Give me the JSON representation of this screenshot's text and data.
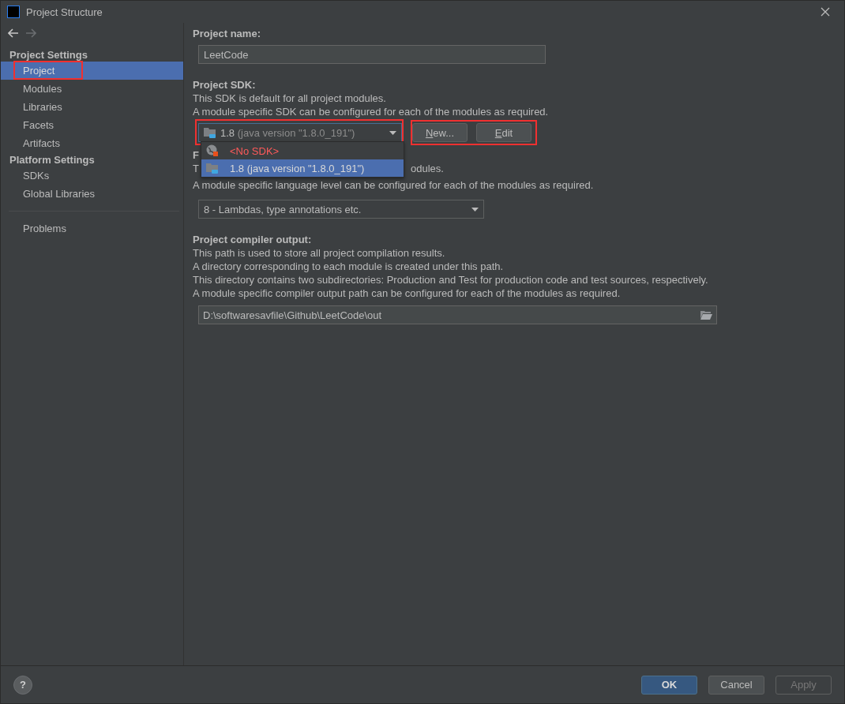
{
  "window": {
    "title": "Project Structure"
  },
  "sidebar": {
    "sections": [
      {
        "title": "Project Settings",
        "items": [
          {
            "label": "Project",
            "selected": true,
            "highlighted": true
          },
          {
            "label": "Modules",
            "selected": false,
            "highlighted": false
          },
          {
            "label": "Libraries",
            "selected": false,
            "highlighted": false
          },
          {
            "label": "Facets",
            "selected": false,
            "highlighted": false
          },
          {
            "label": "Artifacts",
            "selected": false,
            "highlighted": false
          }
        ]
      },
      {
        "title": "Platform Settings",
        "items": [
          {
            "label": "SDKs",
            "selected": false,
            "highlighted": false
          },
          {
            "label": "Global Libraries",
            "selected": false,
            "highlighted": false
          }
        ]
      }
    ],
    "extra_items": [
      {
        "label": "Problems",
        "selected": false
      }
    ]
  },
  "project_name": {
    "label": "Project name:",
    "value": "LeetCode"
  },
  "project_sdk": {
    "label": "Project SDK:",
    "description": [
      "This SDK is default for all project modules.",
      "A module specific SDK can be configured for each of the modules as required."
    ],
    "combo": {
      "version": "1.8",
      "detail": "(java version \"1.8.0_191\")",
      "highlighted": true
    },
    "buttons": [
      {
        "label": "New..."
      },
      {
        "label": "Edit"
      }
    ],
    "buttons_highlighted": true,
    "dropdown": {
      "options": [
        {
          "kind": "none",
          "label": "<No SDK>",
          "selected": false
        },
        {
          "kind": "jdk",
          "label": "1.8 (java version \"1.8.0_191\")",
          "selected": true
        }
      ]
    }
  },
  "language_level": {
    "label_fragment": "F",
    "line_fragments": [
      "T",
      "odules."
    ],
    "description": "A module specific language level can be configured for each of the modules as required.",
    "combo": {
      "value": "8 - Lambdas, type annotations etc."
    }
  },
  "compiler_output": {
    "label": "Project compiler output:",
    "description": [
      "This path is used to store all project compilation results.",
      "A directory corresponding to each module is created under this path.",
      "This directory contains two subdirectories: Production and Test for production code and test sources, respectively.",
      "A module specific compiler output path can be configured for each of the modules as required."
    ],
    "path": "D:\\softwaresavfile\\Github\\LeetCode\\out"
  },
  "footer": {
    "help": "?",
    "buttons": [
      {
        "label": "OK",
        "kind": "primary",
        "disabled": false
      },
      {
        "label": "Cancel",
        "kind": "normal",
        "disabled": false
      },
      {
        "label": "Apply",
        "kind": "normal",
        "disabled": true
      }
    ]
  }
}
